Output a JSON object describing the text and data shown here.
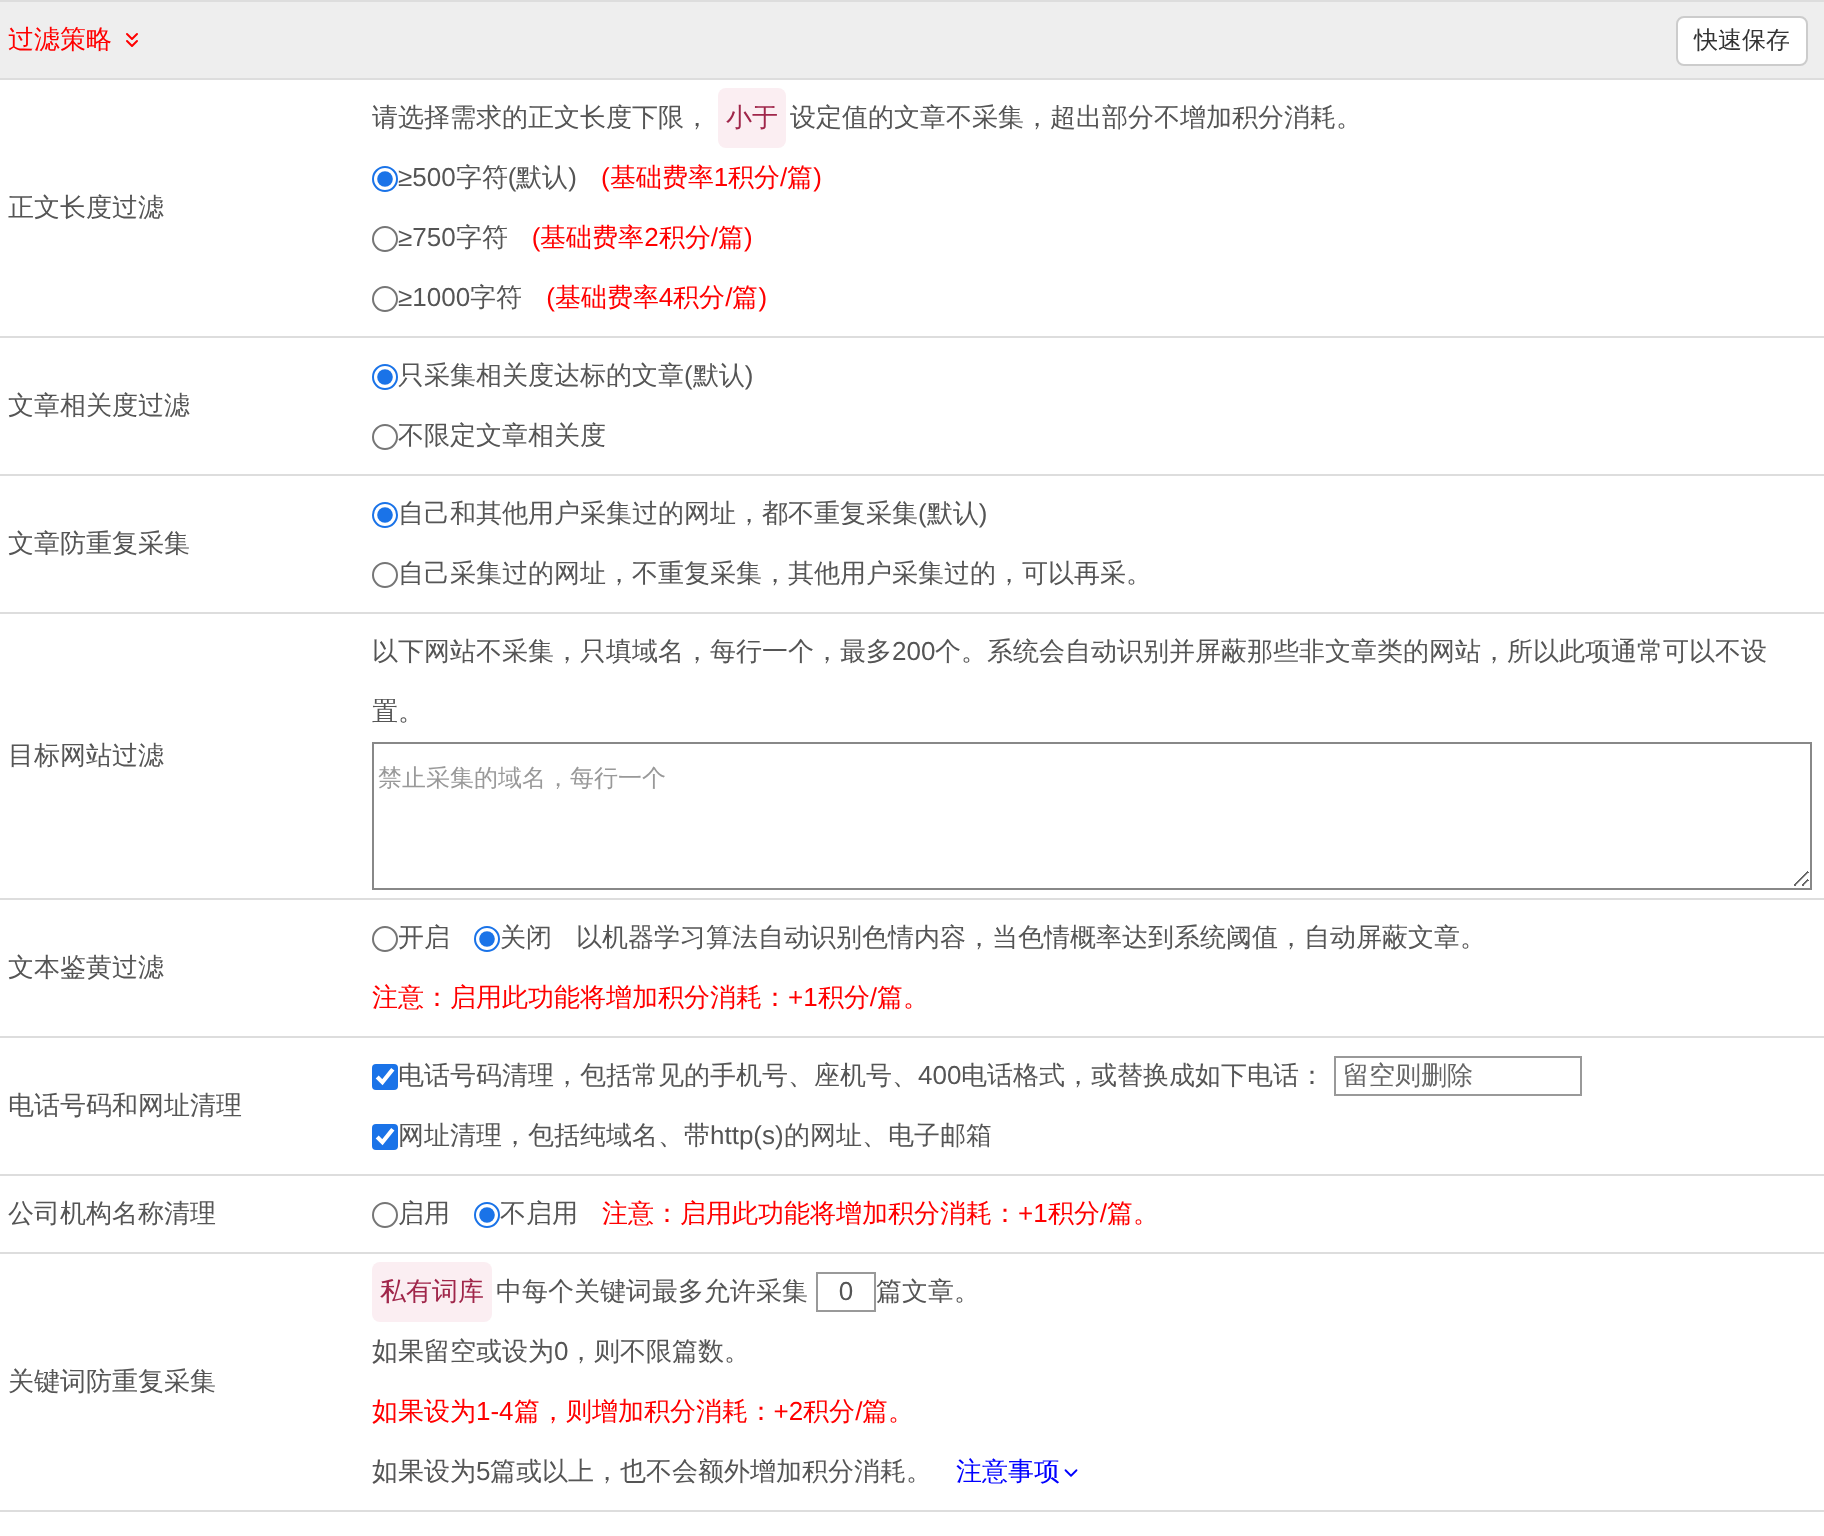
{
  "header": {
    "title": "过滤策略",
    "save_button": "快速保存"
  },
  "rows": [
    {
      "label": "正文长度过滤",
      "lines": [
        [
          {
            "kind": "text",
            "text": "请选择需求的正文长度下限，"
          },
          {
            "kind": "tag",
            "text": "小于"
          },
          {
            "kind": "text",
            "text": "设定值的文章不采集，超出部分不增加积分消耗。"
          }
        ],
        [
          {
            "kind": "radio",
            "label": "≥500字符(默认)",
            "selected": true
          },
          {
            "kind": "warning",
            "text": "(基础费率1积分/篇)"
          }
        ],
        [
          {
            "kind": "radio",
            "label": "≥750字符",
            "selected": false
          },
          {
            "kind": "warning",
            "text": "(基础费率2积分/篇)"
          }
        ],
        [
          {
            "kind": "radio",
            "label": "≥1000字符",
            "selected": false
          },
          {
            "kind": "warning",
            "text": "(基础费率4积分/篇)"
          }
        ]
      ]
    },
    {
      "label": "文章相关度过滤",
      "lines": [
        [
          {
            "kind": "radio",
            "label": "只采集相关度达标的文章(默认)",
            "selected": true
          }
        ],
        [
          {
            "kind": "radio",
            "label": "不限定文章相关度",
            "selected": false
          }
        ]
      ]
    },
    {
      "label": "文章防重复采集",
      "lines": [
        [
          {
            "kind": "radio",
            "label": "自己和其他用户采集过的网址，都不重复采集(默认)",
            "selected": true
          }
        ],
        [
          {
            "kind": "radio",
            "label": "自己采集过的网址，不重复采集，其他用户采集过的，可以再采。",
            "selected": false
          }
        ]
      ]
    },
    {
      "label": "目标网站过滤",
      "lines": [
        [
          {
            "kind": "text",
            "text": "以下网站不采集，只填域名，每行一个，最多200个。系统会自动识别并屏蔽那些非文章类的网站，所以此项通常可以不设置。"
          }
        ],
        [
          {
            "kind": "textarea",
            "placeholder": "禁止采集的域名，每行一个"
          }
        ]
      ]
    },
    {
      "label": "文本鉴黄过滤",
      "lines": [
        [
          {
            "kind": "radio",
            "label": "开启",
            "selected": false
          },
          {
            "kind": "radio",
            "label": "关闭",
            "selected": true
          },
          {
            "kind": "text",
            "text": "以机器学习算法自动识别色情内容，当色情概率达到系统阈值，自动屏蔽文章。"
          }
        ],
        [
          {
            "kind": "warning",
            "text": "注意：启用此功能将增加积分消耗：+1积分/篇。"
          }
        ]
      ]
    },
    {
      "label": "电话号码和网址清理",
      "lines": [
        [
          {
            "kind": "checkbox",
            "label": "电话号码清理，包括常见的手机号、座机号、400电话格式，或替换成如下电话：",
            "checked": true
          },
          {
            "kind": "input",
            "placeholder": "留空则删除"
          }
        ],
        [
          {
            "kind": "checkbox",
            "label": "网址清理，包括纯域名、带http(s)的网址、电子邮箱",
            "checked": true
          }
        ]
      ]
    },
    {
      "label": "公司机构名称清理",
      "lines": [
        [
          {
            "kind": "radio",
            "label": "启用",
            "selected": false
          },
          {
            "kind": "radio",
            "label": "不启用",
            "selected": true
          },
          {
            "kind": "warning",
            "text": "注意：启用此功能将增加积分消耗：+1积分/篇。"
          }
        ]
      ]
    },
    {
      "label": "关键词防重复采集",
      "lines": [
        [
          {
            "kind": "tag",
            "text": "私有词库"
          },
          {
            "kind": "text",
            "text": "中每个关键词最多允许采集"
          },
          {
            "kind": "number",
            "value": "0"
          },
          {
            "kind": "text",
            "text": "篇文章。"
          }
        ],
        [
          {
            "kind": "text",
            "text": "如果留空或设为0，则不限篇数。"
          }
        ],
        [
          {
            "kind": "warning",
            "text": "如果设为1-4篇，则增加积分消耗：+2积分/篇。"
          }
        ],
        [
          {
            "kind": "text",
            "text": "如果设为5篇或以上，也不会额外增加积分消耗。"
          },
          {
            "kind": "link",
            "text": "注意事项"
          }
        ]
      ]
    }
  ]
}
